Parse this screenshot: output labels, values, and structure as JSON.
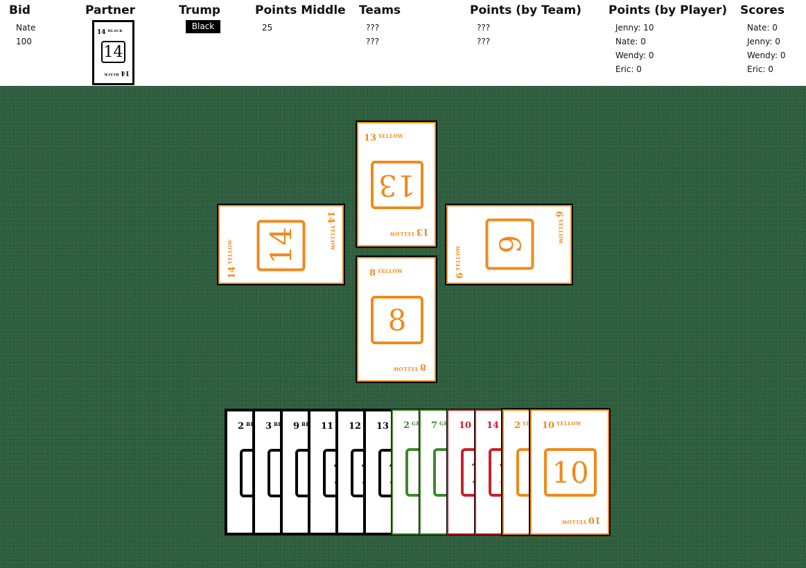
{
  "header": {
    "bid": {
      "label": "Bid",
      "player": "Nate",
      "amount": "100"
    },
    "partner": {
      "label": "Partner",
      "card": {
        "number": "14",
        "suit": "BLACK"
      }
    },
    "trump": {
      "label": "Trump",
      "value": "Black"
    },
    "points_middle": {
      "label": "Points Middle",
      "value": "25"
    },
    "teams": {
      "label": "Teams",
      "rows": [
        "???",
        "???"
      ]
    },
    "points_by_team": {
      "label": "Points (by Team)",
      "rows": [
        "???",
        "???"
      ]
    },
    "points_by_player": {
      "label": "Points (by Player)",
      "rows": [
        "Jenny: 10",
        "Nate: 0",
        "Wendy: 0",
        "Eric: 0"
      ]
    },
    "scores": {
      "label": "Scores",
      "rows": [
        "Nate: 0",
        "Jenny: 0",
        "Wendy: 0",
        "Eric: 0"
      ]
    }
  },
  "trick": {
    "top": {
      "number": "13",
      "suit": "YELLOW",
      "color": "orange"
    },
    "left": {
      "number": "14",
      "suit": "YELLOW",
      "color": "orange"
    },
    "right": {
      "number": "6",
      "suit": "YELLOW",
      "color": "orange"
    },
    "bottom": {
      "number": "8",
      "suit": "YELLOW",
      "color": "orange"
    }
  },
  "hand": [
    {
      "number": "2",
      "suit": "BLACK",
      "color": "black"
    },
    {
      "number": "3",
      "suit": "BLACK",
      "color": "black"
    },
    {
      "number": "9",
      "suit": "BLACK",
      "color": "black"
    },
    {
      "number": "11",
      "suit": "BLACK",
      "color": "black"
    },
    {
      "number": "12",
      "suit": "BLACK",
      "color": "black"
    },
    {
      "number": "13",
      "suit": "BLACK",
      "color": "black"
    },
    {
      "number": "2",
      "suit": "GREEN",
      "color": "green"
    },
    {
      "number": "7",
      "suit": "GREEN",
      "color": "green"
    },
    {
      "number": "10",
      "suit": "RED",
      "color": "red"
    },
    {
      "number": "14",
      "suit": "RED",
      "color": "red"
    },
    {
      "number": "2",
      "suit": "YELLOW",
      "color": "orange"
    },
    {
      "number": "10",
      "suit": "YELLOW",
      "color": "orange"
    }
  ],
  "colors": {
    "orange": "#f08a1a",
    "black": "#000000",
    "green": "#3a8a2a",
    "red": "#c8202a",
    "felt": "#2e5e3d"
  }
}
